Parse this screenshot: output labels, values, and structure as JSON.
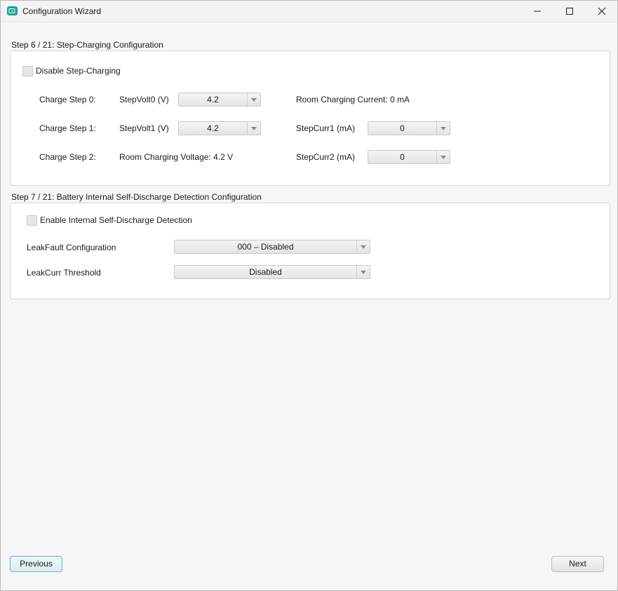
{
  "window": {
    "title": "Configuration Wizard",
    "icon": "battery-charge-icon",
    "controls": [
      "minimize-icon",
      "maximize-icon",
      "close-icon"
    ]
  },
  "step6": {
    "title": "Step 6 / 21: Step-Charging Configuration",
    "disable_checkbox": {
      "label": "Disable Step-Charging",
      "checked": false
    },
    "rows": [
      {
        "step_label": "Charge Step 0:",
        "param_label": "StepVolt0 (V)",
        "param_value": "4.2",
        "info": "Room Charging Current: 0 mA"
      },
      {
        "step_label": "Charge Step 1:",
        "param_label": "StepVolt1 (V)",
        "param_value": "4.2",
        "curr_label": "StepCurr1 (mA)",
        "curr_value": "0"
      },
      {
        "step_label": "Charge Step 2:",
        "info": "Room Charging Voltage: 4.2 V",
        "curr_label": "StepCurr2 (mA)",
        "curr_value": "0"
      }
    ]
  },
  "step7": {
    "title": "Step 7 / 21: Battery Internal Self-Discharge Detection Configuration",
    "enable_checkbox": {
      "label": "Enable Internal Self-Discharge Detection",
      "checked": false
    },
    "leakfault": {
      "label": "LeakFault Configuration",
      "value": "000 – Disabled"
    },
    "leakcurr": {
      "label": "LeakCurr Threshold",
      "value": "Disabled"
    }
  },
  "footer": {
    "previous_label": "Previous",
    "next_label": "Next"
  },
  "colors": {
    "accent": "#1aa39a",
    "focus_border": "#5fb7c4"
  }
}
